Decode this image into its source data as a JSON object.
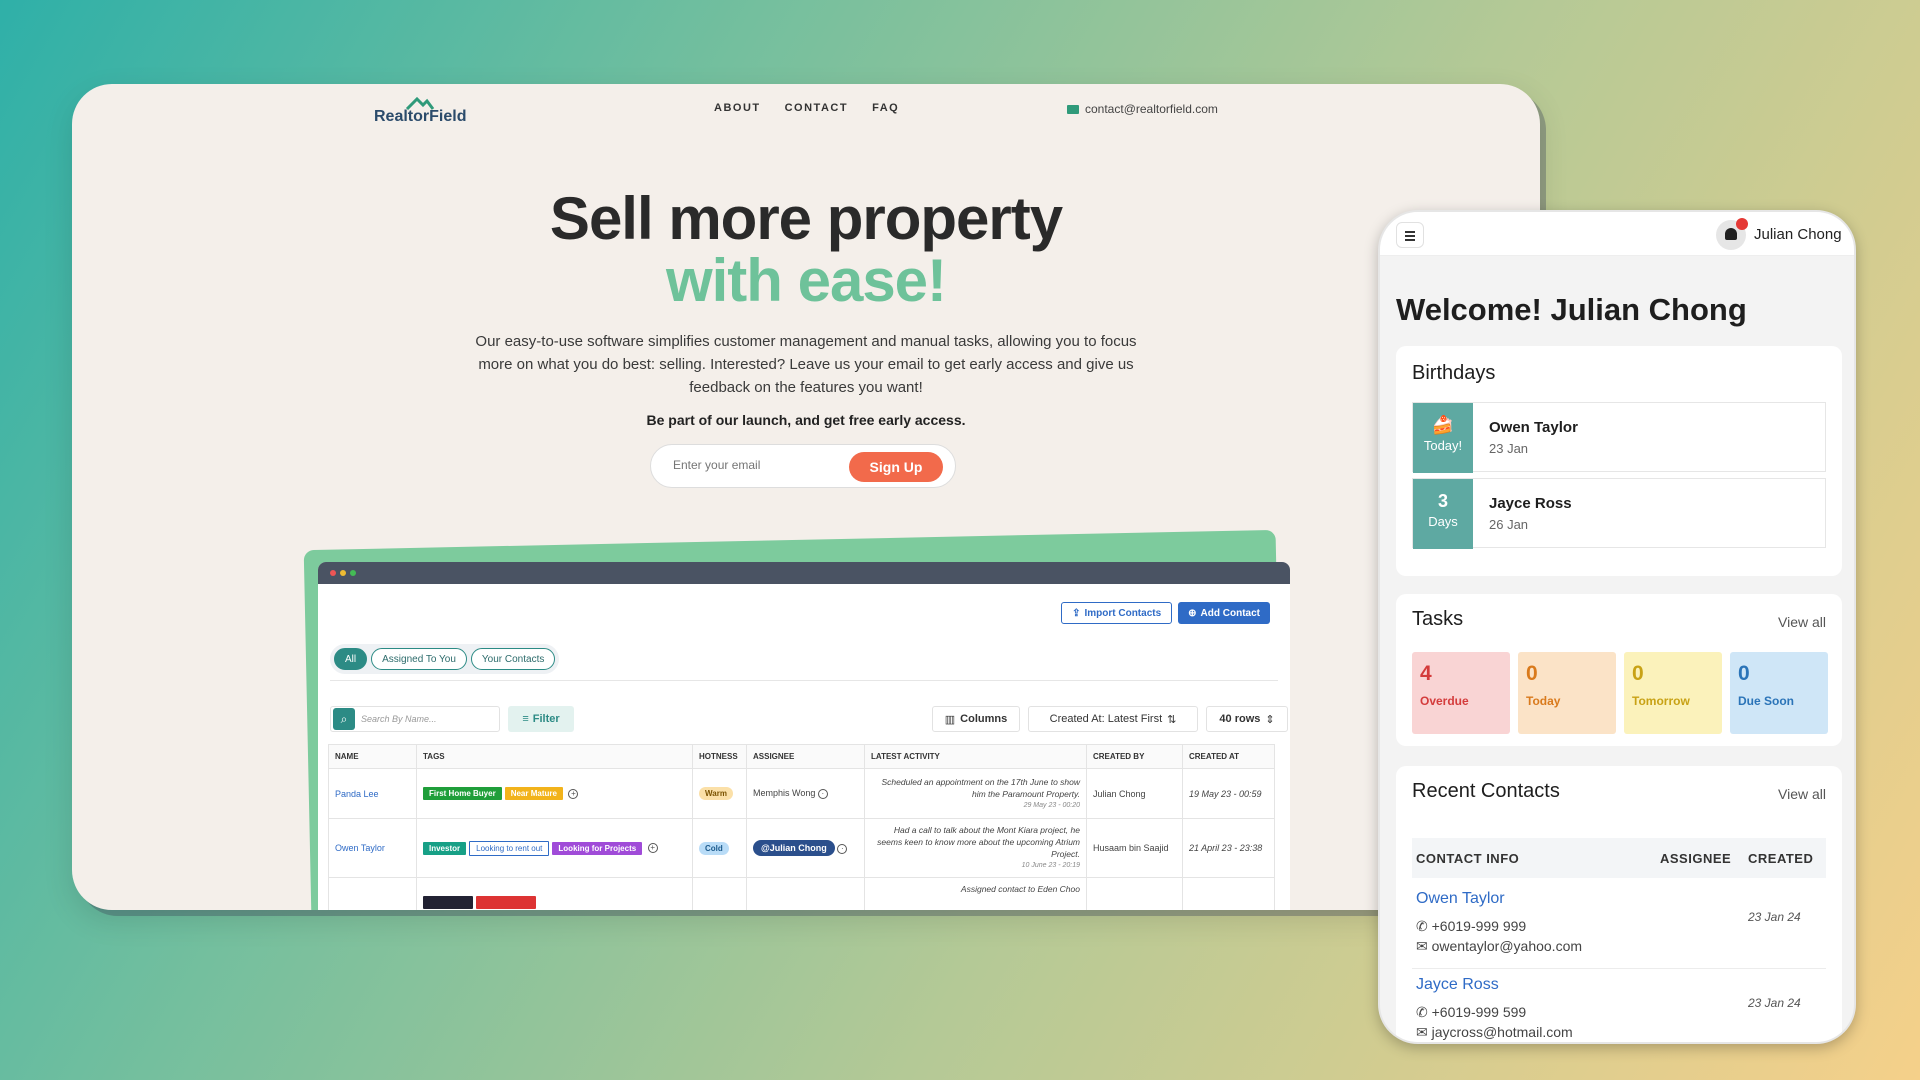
{
  "site": {
    "logo": "RealtorField",
    "nav": [
      "ABOUT",
      "CONTACT",
      "FAQ"
    ],
    "email": "contact@realtorfield.com",
    "hero_line1": "Sell more property",
    "hero_line2": "with ease!",
    "description": "Our easy-to-use software simplifies customer management and manual tasks, allowing you to focus more on what you do best: selling. Interested? Leave us your email to get early access and give us feedback on the features you want!",
    "cta": "Be part of our launch, and get free early access.",
    "email_placeholder": "Enter your email",
    "signup_label": "Sign Up",
    "colors": {
      "accent_green": "#6ec29a",
      "signup_orange": "#f26a4b",
      "navy": "#2b4b6b"
    }
  },
  "mockup": {
    "import_label": "Import Contacts",
    "add_label": "Add Contact",
    "tabs": [
      "All",
      "Assigned To You",
      "Your Contacts"
    ],
    "search_placeholder": "Search By Name...",
    "filter_label": "Filter",
    "columns_label": "Columns",
    "sort_label": "Created At: Latest First",
    "rows_label": "40 rows",
    "headers": [
      "NAME",
      "TAGS",
      "HOTNESS",
      "ASSIGNEE",
      "LATEST ACTIVITY",
      "CREATED BY",
      "CREATED AT"
    ],
    "rows": [
      {
        "name": "Panda Lee",
        "tags": [
          {
            "label": "First Home Buyer",
            "color": "#1f9e3a"
          },
          {
            "label": "Near Mature",
            "color": "#f2b31b"
          }
        ],
        "hotness": "Warm",
        "assignee": "Memphis Wong",
        "activity": "Scheduled an appointment on the 17th June to show him the Paramount Property.",
        "activity_time": "29 May 23 - 00:20",
        "created_by": "Julian Chong",
        "created_at": "19 May 23 - 00:59"
      },
      {
        "name": "Owen Taylor",
        "tags": [
          {
            "label": "Investor",
            "color": "#17a086"
          },
          {
            "label": "Looking to rent out",
            "color": "outline"
          },
          {
            "label": "Looking for Projects",
            "color": "#a04bd8"
          }
        ],
        "hotness": "Cold",
        "assignee": "@Julian Chong",
        "activity": "Had a call to talk about the Mont Kiara project, he seems keen to know more about the upcoming Atrium Project.",
        "activity_time": "10 June 23 - 20:19",
        "created_by": "Husaam bin Saajid",
        "created_at": "21 April 23 - 23:38"
      }
    ],
    "partial_activity": "Assigned contact to Eden Choo"
  },
  "mobile": {
    "user": "Julian Chong",
    "welcome": "Welcome! Julian Chong",
    "birthdays_title": "Birthdays",
    "birthdays": [
      {
        "badge_top": "🍰",
        "badge_bottom": "Today!",
        "name": "Owen Taylor",
        "date": "23 Jan"
      },
      {
        "badge_top": "3",
        "badge_bottom": "Days",
        "name": "Jayce Ross",
        "date": "26 Jan"
      }
    ],
    "tasks_title": "Tasks",
    "tasks_view_all": "View all",
    "tasks": [
      {
        "count": "4",
        "label": "Overdue",
        "bg": "#f9d4d4",
        "fg": "#d43c3c"
      },
      {
        "count": "0",
        "label": "Today",
        "bg": "#fbe3c7",
        "fg": "#d97a1c"
      },
      {
        "count": "0",
        "label": "Tomorrow",
        "bg": "#fbf2bb",
        "fg": "#c8a215"
      },
      {
        "count": "0",
        "label": "Due Soon",
        "bg": "#cfe6f7",
        "fg": "#2b74b8"
      }
    ],
    "recent_title": "Recent Contacts",
    "recent_view_all": "View all",
    "recent_headers": [
      "CONTACT INFO",
      "ASSIGNEE",
      "CREATED"
    ],
    "contacts": [
      {
        "name": "Owen Taylor",
        "phone": "+6019-999 999",
        "email": "owentaylor@yahoo.com",
        "created": "23 Jan 24"
      },
      {
        "name": "Jayce Ross",
        "phone": "+6019-999 599",
        "email": "jaycross@hotmail.com",
        "created": "23 Jan 24"
      }
    ]
  }
}
